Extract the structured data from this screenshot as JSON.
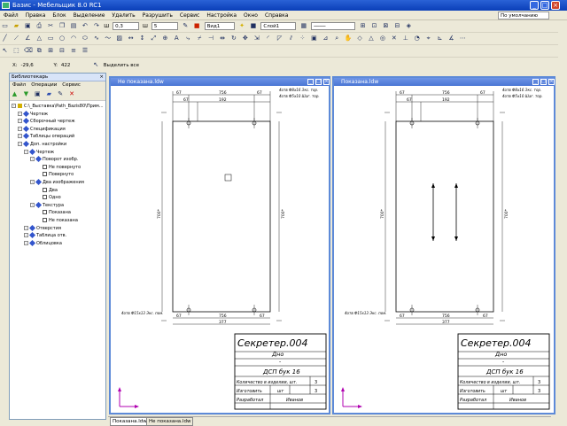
{
  "window": {
    "title": "Базис - Мебельщик 8.0 RC1"
  },
  "menu": [
    "Файл",
    "Правка",
    "Блок",
    "Выделение",
    "Удалить",
    "Разрушить",
    "Сервис",
    "Настройка",
    "Окно",
    "Справка"
  ],
  "mode_select": "По умолчанию",
  "toolbar": {
    "line_width": "0,3",
    "line_width_label": "Ш",
    "line_type": "5",
    "view_select": "Вид1",
    "layer_select": "Слой1"
  },
  "coords": {
    "x_label": "X:",
    "x_value": "-29,6",
    "y_label": "Y:",
    "y_value": "422",
    "select_all": "Выделить все"
  },
  "library_panel": {
    "title": "Библиотекарь",
    "menu": [
      "Файл",
      "Операции",
      "Сервис"
    ],
    "tree": [
      {
        "label": "C:\\_Выставка\\Path_Bazis80\\Прим...",
        "level": 0,
        "icon": "folder"
      },
      {
        "label": "Чертеж",
        "level": 1,
        "icon": "diamond"
      },
      {
        "label": "Сборочный чертеж",
        "level": 1,
        "icon": "diamond"
      },
      {
        "label": "Спецификация",
        "level": 1,
        "icon": "diamond"
      },
      {
        "label": "Таблицы операций",
        "level": 1,
        "icon": "diamond"
      },
      {
        "label": "Доп. настройки",
        "level": 1,
        "icon": "diamond"
      },
      {
        "label": "Чертеж",
        "level": 2,
        "icon": "diamond"
      },
      {
        "label": "Поворот изобр.",
        "level": 3,
        "icon": "diamond"
      },
      {
        "label": "Не повернуто",
        "level": 4,
        "icon": "check"
      },
      {
        "label": "Повернуто",
        "level": 4,
        "icon": "check"
      },
      {
        "label": "Два изображения",
        "level": 3,
        "icon": "diamond"
      },
      {
        "label": "Два",
        "level": 4,
        "icon": "check"
      },
      {
        "label": "Одно",
        "level": 4,
        "icon": "check"
      },
      {
        "label": "Текстура",
        "level": 3,
        "icon": "diamond"
      },
      {
        "label": "Показана",
        "level": 4,
        "icon": "check"
      },
      {
        "label": "Не показана",
        "level": 4,
        "icon": "check"
      },
      {
        "label": "Отверстия",
        "level": 2,
        "icon": "diamond"
      },
      {
        "label": "Таблица отв.",
        "level": 2,
        "icon": "diamond"
      },
      {
        "label": "Облицовка",
        "level": 2,
        "icon": "diamond"
      }
    ]
  },
  "documents": [
    {
      "title": "Не показана.ldw",
      "stamp": {
        "name": "Секретер.004",
        "part": "Дно",
        "dash": "-",
        "material": "ДСП бук 16",
        "qty_label": "Количество в изделии, шт.",
        "qty": "3",
        "made_label": "Изготовить",
        "made_unit": "шт",
        "made_qty": "3",
        "author_label": "Разработал",
        "author": "Иванов"
      },
      "dims": {
        "top_total": "377",
        "top_mid": "756",
        "top_left": "67",
        "top_right": "67",
        "top_inner": "192",
        "side": "700*",
        "bottom_total": "377",
        "bottom_mid": "756",
        "bottom_left": "67",
        "bottom_right": "67"
      },
      "notes": {
        "top": "4отв Ф8х16 Экс. тор.",
        "top2": "4отв Ф5х10 Шаг. тор.",
        "bottom": "4отв Ф15х13 Экс. пом."
      }
    },
    {
      "title": "Показана.ldw",
      "stamp": {
        "name": "Секретер.004",
        "part": "Дно",
        "dash": "-",
        "material": "ДСП бук 16",
        "qty_label": "Количество в изделии, шт.",
        "qty": "3",
        "made_label": "Изготовить",
        "made_unit": "шт",
        "made_qty": "3",
        "author_label": "Разработал",
        "author": "Иванов"
      },
      "dims": {
        "top_total": "377",
        "top_mid": "756",
        "top_left": "67",
        "top_right": "67",
        "top_inner": "192",
        "side": "700*",
        "bottom_total": "377",
        "bottom_mid": "756",
        "bottom_left": "67",
        "bottom_right": "67"
      },
      "notes": {
        "top": "4отв Ф8х16 Экс. тор.",
        "top2": "4отв Ф5х10 Шаг. тор.",
        "bottom": "4отв Ф15х13 Экс. пом."
      }
    }
  ],
  "bottom_tabs": [
    "Показана.ldw",
    "Не показана.ldw"
  ],
  "colors": {
    "titlebar": "#0a3fb8",
    "doc_title": "#4a76d4",
    "axis": "#b000b0",
    "tree_icon": "#3355cc"
  }
}
